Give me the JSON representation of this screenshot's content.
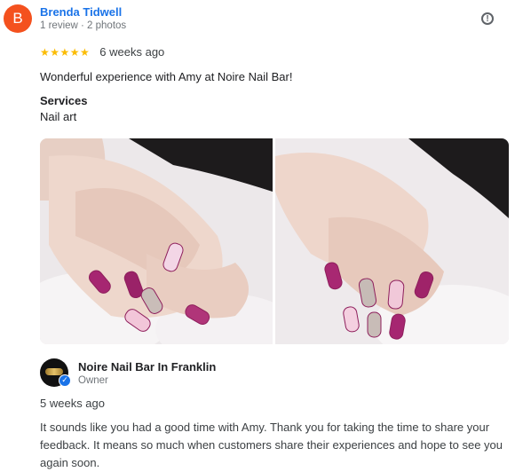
{
  "reviewer": {
    "initial": "B",
    "name": "Brenda Tidwell",
    "meta": "1 review · 2 photos",
    "avatar_color": "#f4511e"
  },
  "review": {
    "stars": "★★★★★",
    "rating": 5,
    "date": "6 weeks ago",
    "text": "Wonderful experience with Amy at Noire Nail Bar!",
    "services_label": "Services",
    "services_value": "Nail art"
  },
  "icons": {
    "report": "report-icon",
    "verified": "verified-check-icon"
  },
  "owner_reply": {
    "owner_name": "Noire Nail Bar In Franklin",
    "role": "Owner",
    "date": "5 weeks ago",
    "text": "It sounds like you had a good time with Amy. Thank you for taking the time to share your feedback. It means so much when customers share their experiences and hope to see you again soon."
  },
  "colors": {
    "name_link": "#1a73e8",
    "star": "#fbbc04",
    "nail_accent": "#8e1f5c"
  }
}
